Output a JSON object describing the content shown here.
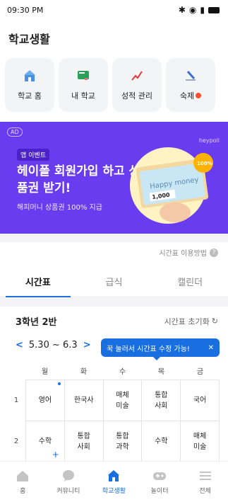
{
  "status": {
    "time": "09:30 PM",
    "bluetooth": "✱",
    "wifi": "◉",
    "signal": "📶"
  },
  "page_title": "학교생활",
  "quick_menu": [
    {
      "label": "학교 홈",
      "icon": "school-icon",
      "badge": ""
    },
    {
      "label": "내 학교",
      "icon": "blackboard-icon",
      "badge": ""
    },
    {
      "label": "성적 관리",
      "icon": "chart-icon",
      "badge": ""
    },
    {
      "label": "숙제",
      "icon": "pencil-icon",
      "badge": "N"
    }
  ],
  "banner": {
    "ad": "AD",
    "brand": "heypoll",
    "tag": "앱 이벤트",
    "title": "헤이폴 회원가입 하고 상품권 받기!",
    "subtitle": "해피머니 상품권 100% 지급",
    "coin_text": "100%",
    "card_text": "Happy money",
    "card_value": "1,000"
  },
  "guide_link": "시간표 이용방법",
  "tabs": [
    {
      "label": "시간표",
      "active": true
    },
    {
      "label": "급식",
      "active": false
    },
    {
      "label": "캘린더",
      "active": false
    }
  ],
  "timetable": {
    "class_name": "3학년 2반",
    "reset_label": "시간표 초기화",
    "week_range": "5.30 ~ 6.3",
    "prev": "<",
    "next": ">",
    "tooltip": "꾹 눌러서 시간표 수정 가능!",
    "tooltip_close": "✕",
    "days": [
      "월",
      "화",
      "수",
      "목",
      "금"
    ],
    "periods": [
      {
        "num": "1",
        "cells": [
          "영어",
          "한국사",
          "매체\n미술",
          "통합\n사회",
          "국어"
        ]
      },
      {
        "num": "2",
        "cells": [
          "수학",
          "통합\n사회",
          "통합\n과학",
          "수학",
          "매체\n미술"
        ]
      }
    ]
  },
  "bottom_nav": [
    {
      "label": "홈",
      "icon": "home-icon",
      "active": false
    },
    {
      "label": "커뮤니티",
      "icon": "chat-bubble-icon",
      "active": false
    },
    {
      "label": "학교생활",
      "icon": "school-icon",
      "active": true
    },
    {
      "label": "놀이터",
      "icon": "gamepad-icon",
      "active": false
    },
    {
      "label": "전체",
      "icon": "menu-icon",
      "active": false
    }
  ],
  "colors": {
    "accent": "#1a6fe0",
    "banner_bg": "#6a3cf0",
    "badge_red": "#ff4d2d"
  }
}
